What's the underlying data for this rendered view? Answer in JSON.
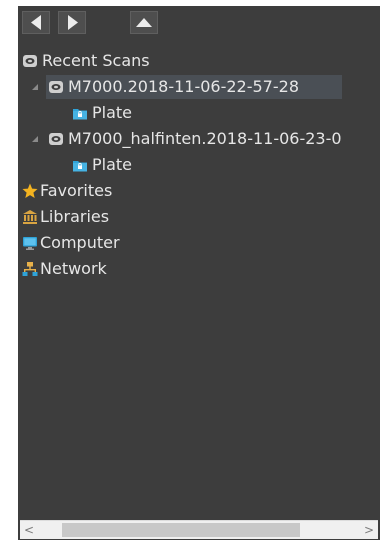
{
  "toolbar": {
    "back_icon": "triangle-left-icon",
    "forward_icon": "triangle-right-icon",
    "up_icon": "triangle-up-icon"
  },
  "tree": {
    "recent_scans": {
      "label": "Recent Scans",
      "icon": "scan-drive-icon"
    },
    "scan1": {
      "label": "M7000.2018-11-06-22-57-28",
      "icon": "scan-drive-icon",
      "expanded": true,
      "selected": true
    },
    "scan1_plate": {
      "label": "Plate",
      "icon": "plate-folder-icon"
    },
    "scan2": {
      "label": "M7000_halfinten.2018-11-06-23-0",
      "icon": "scan-drive-icon",
      "expanded": true
    },
    "scan2_plate": {
      "label": "Plate",
      "icon": "plate-folder-icon"
    },
    "favorites": {
      "label": "Favorites",
      "icon": "star-icon"
    },
    "libraries": {
      "label": "Libraries",
      "icon": "library-icon"
    },
    "computer": {
      "label": "Computer",
      "icon": "monitor-icon"
    },
    "network": {
      "label": "Network",
      "icon": "network-icon"
    }
  },
  "scrollbar": {
    "left_arrow": "<",
    "right_arrow": ">"
  },
  "colors": {
    "panel_bg": "#3d3d3d",
    "text": "#e6e6e6",
    "selection": "#4a4f55",
    "folder_blue": "#2fa3d8",
    "star": "#f3b320"
  }
}
